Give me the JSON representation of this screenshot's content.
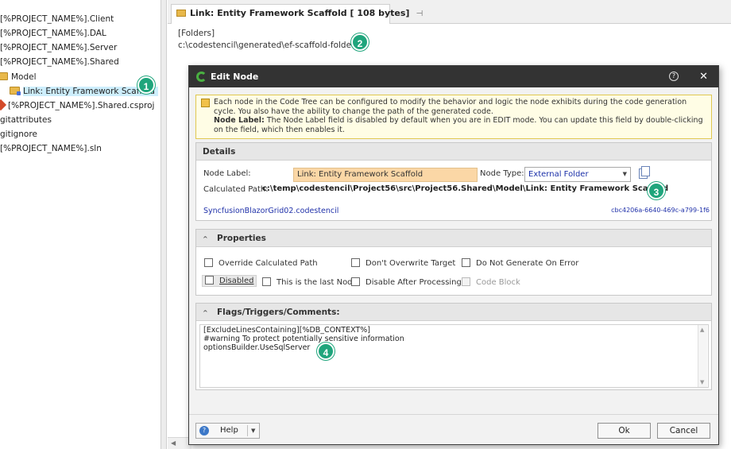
{
  "tree": {
    "items": [
      {
        "label": "[%PROJECT_NAME%].Client"
      },
      {
        "label": "[%PROJECT_NAME%].DAL"
      },
      {
        "label": "[%PROJECT_NAME%].Server"
      },
      {
        "label": "[%PROJECT_NAME%].Shared"
      },
      {
        "label": "Model"
      },
      {
        "label": "Link: Entity Framework Scaffold"
      },
      {
        "label": "[%PROJECT_NAME%].Shared.csproj"
      },
      {
        "label": "gitattributes"
      },
      {
        "label": "gitignore"
      },
      {
        "label": "[%PROJECT_NAME%].sln"
      }
    ]
  },
  "document": {
    "tab_title": "Link: Entity Framework Scaffold [ 108 bytes]",
    "folders_label": "[Folders]",
    "folders_path": "c:\\codestencil\\generated\\ef-scaffold-folder"
  },
  "callouts": [
    "1",
    "2",
    "3",
    "4"
  ],
  "dialog": {
    "title": "Edit Node",
    "help_icon": "?",
    "close_icon": "✕",
    "info": {
      "line1": "Each node in the Code Tree can be configured to modify the behavior and logic the node exhibits during the code generation cycle. You also have the ability to change the path of the generated code.",
      "bold_label": "Node Label:",
      "line2": " The Node Label field is disabled by default when you are in EDIT mode. You can update this field by double-clicking on the field, which then enables it."
    },
    "details": {
      "header": "Details",
      "node_label_caption": "Node Label:",
      "node_label_value": "Link: Entity Framework Scaffold",
      "node_type_caption": "Node Type:",
      "node_type_value": "External Folder",
      "calc_path_caption": "Calculated Path:",
      "calc_path_value": "c:\\temp\\codestencil\\Project56\\src\\Project56.Shared\\Model\\Link: Entity Framework Scaffold",
      "template_link": "SyncfusionBlazorGrid02.codestencil",
      "guid": "cbc4206a-6640-469c-a799-1f6"
    },
    "properties": {
      "header": "Properties",
      "chevron": "^",
      "checkboxes": [
        {
          "label": "Override Calculated Path",
          "checked": false
        },
        {
          "label": "Don't Overwrite Target",
          "checked": false
        },
        {
          "label": "Do Not Generate On Error",
          "checked": false
        },
        {
          "label": "Disabled",
          "checked": false
        },
        {
          "label": "This is the last Node",
          "checked": false
        },
        {
          "label": "Disable After Processing",
          "checked": false
        },
        {
          "label": "Code Block",
          "checked": false
        }
      ]
    },
    "flags": {
      "header": "Flags/Triggers/Comments:",
      "chevron": "^",
      "text": "[ExcludeLinesContaining][%DB_CONTEXT%]\n#warning To protect potentially sensitive information\noptionsBuilder.UseSqlServer"
    },
    "buttons": {
      "help": "Help",
      "ok": "Ok",
      "cancel": "Cancel"
    }
  },
  "colors": {
    "callout": "#1fa57c",
    "dialog_title_bg": "#333333",
    "selected_tree_bg": "#cdeefc",
    "node_label_bg": "#fbd7a6"
  }
}
